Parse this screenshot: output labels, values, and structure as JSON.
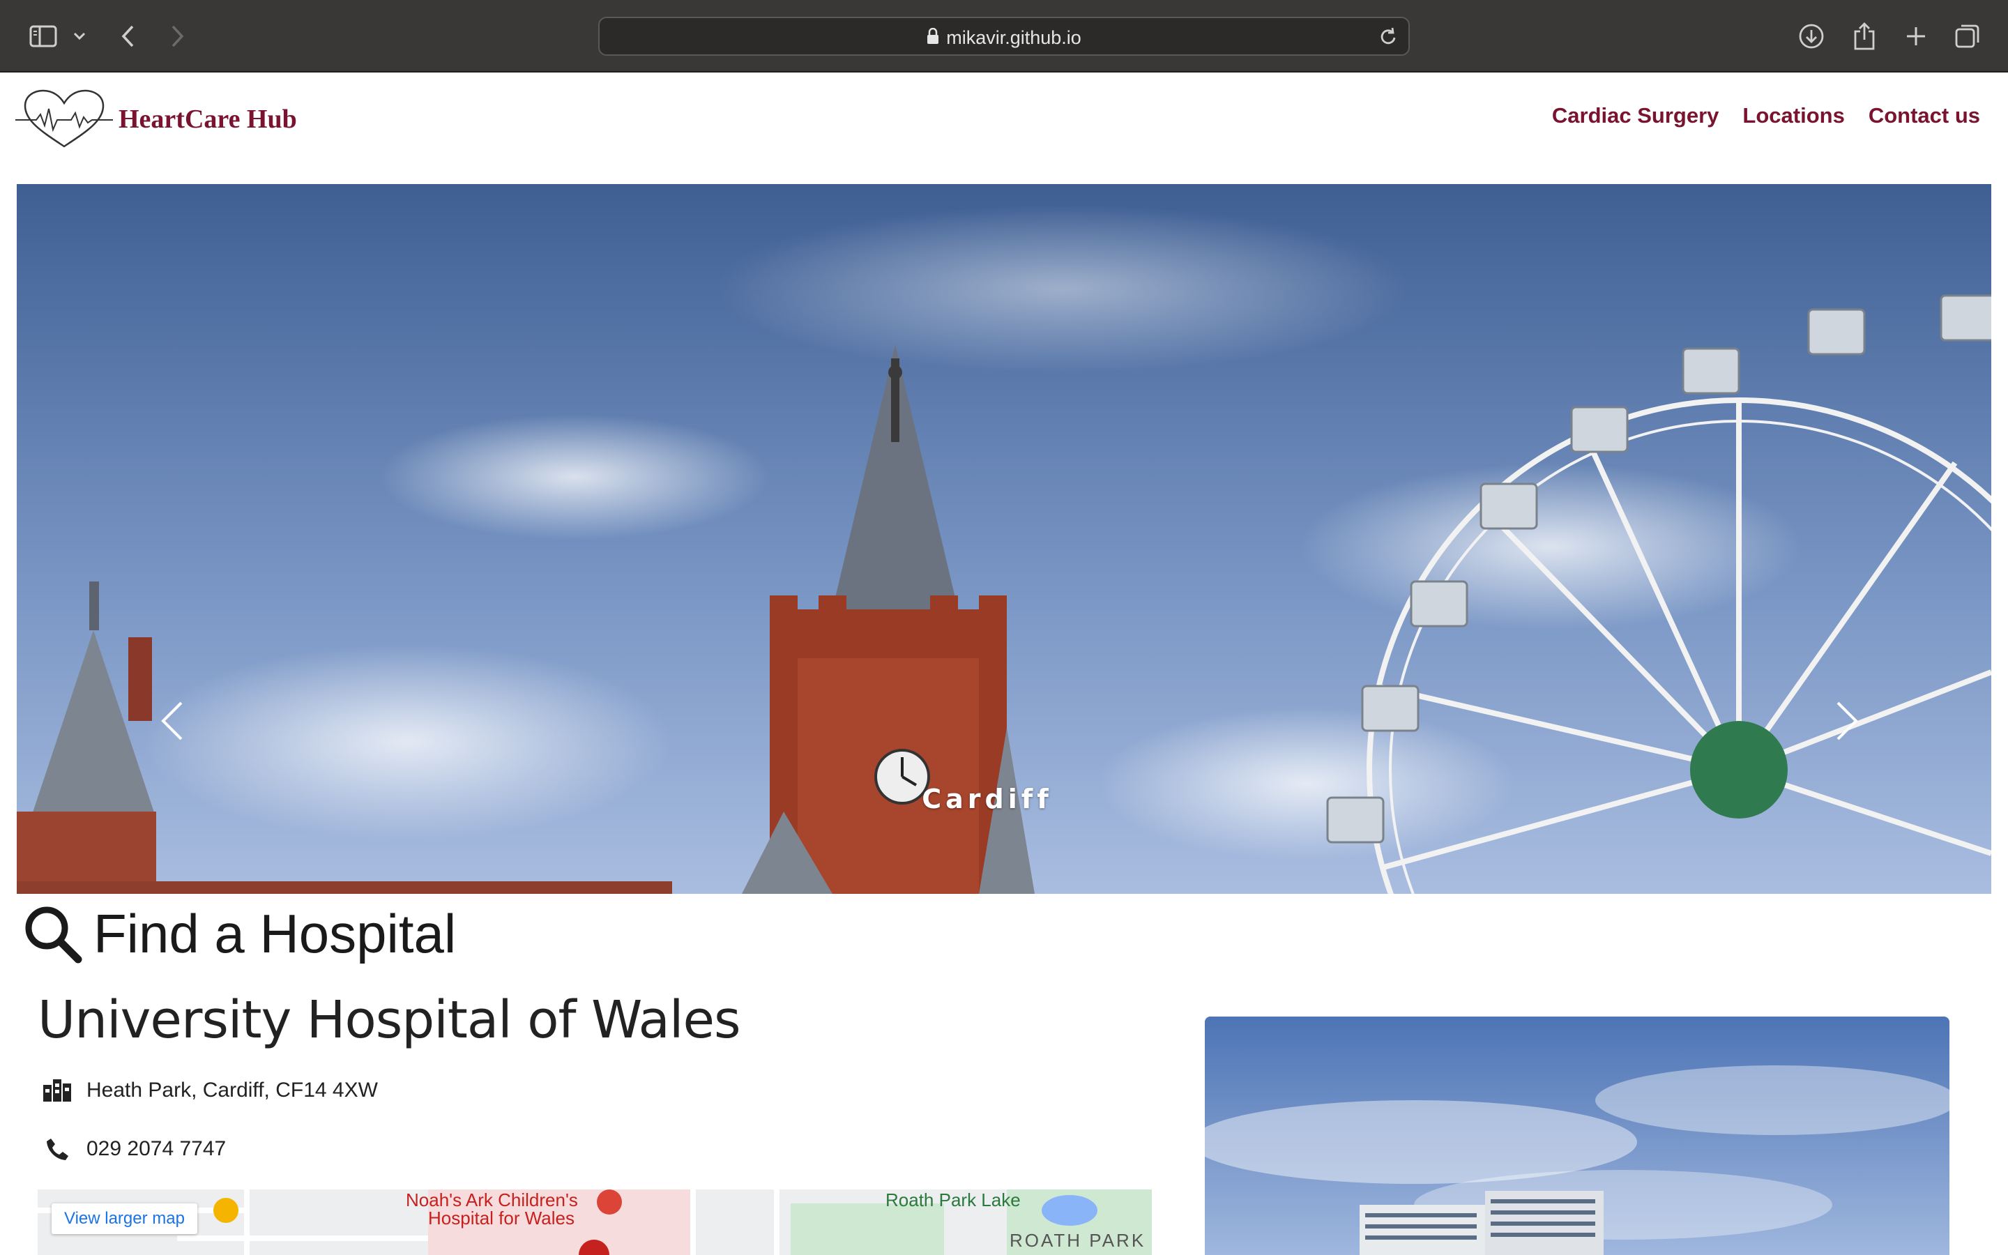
{
  "browser": {
    "url": "mikavir.github.io"
  },
  "site": {
    "brand": "HeartCare Hub",
    "nav": [
      "Cardiac Surgery",
      "Locations",
      "Contact us"
    ]
  },
  "hero": {
    "caption": "Cardiff"
  },
  "find": {
    "heading": "Find a Hospital"
  },
  "hospital": {
    "name": "University Hospital of Wales",
    "address": "Heath Park, Cardiff, CF14 4XW",
    "phone": "029 2074 7747"
  },
  "map": {
    "button": "View larger map",
    "labels": [
      "Noah's Ark Children's",
      "Hospital for Wales",
      "Roath Park Lake",
      "ROATH PARK"
    ]
  }
}
